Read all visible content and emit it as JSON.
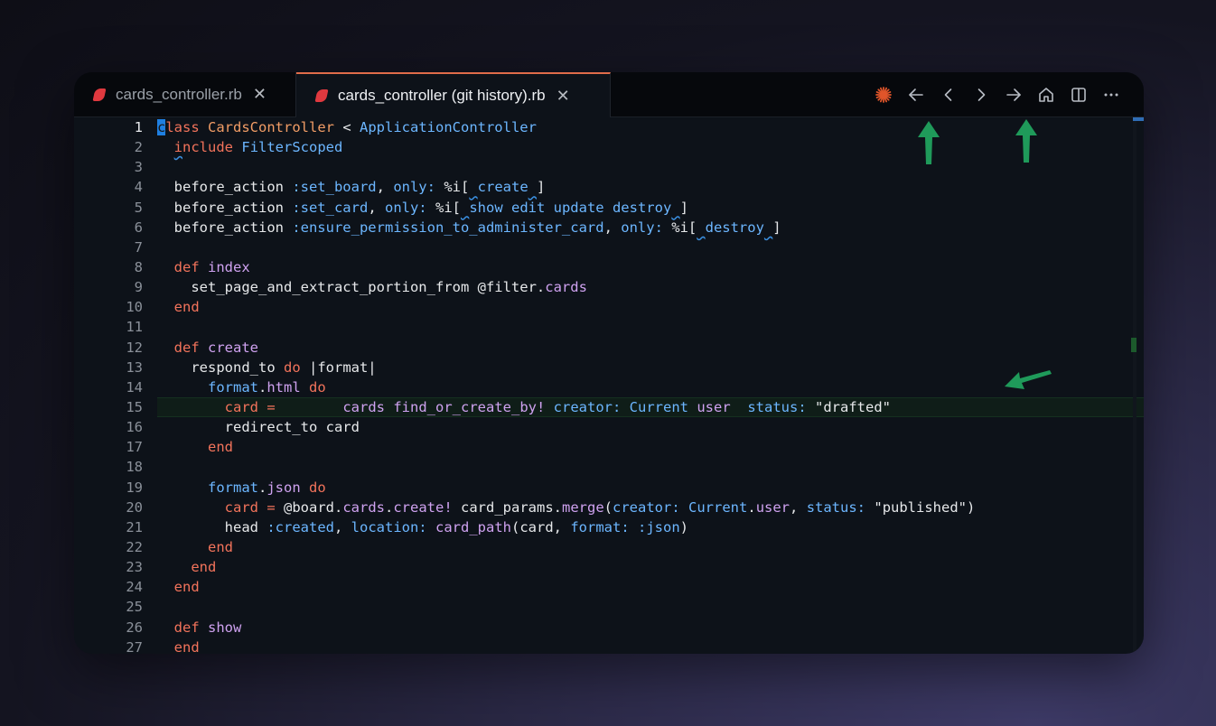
{
  "tabs": [
    {
      "label": "cards_controller.rb",
      "close": "✕",
      "active": false
    },
    {
      "label": "cards_controller (git history).rb",
      "close": "✕",
      "active": true
    }
  ],
  "toolbar": {
    "icons": [
      "sparkle-icon",
      "arrow-left-icon",
      "chevron-left-icon",
      "chevron-right-icon",
      "arrow-right-icon",
      "home-icon",
      "split-icon",
      "more-icon"
    ],
    "accent": "#e0552a"
  },
  "editor": {
    "active_line": 1,
    "highlighted_line": 15,
    "line_numbers": [
      "1",
      "2",
      "3",
      "4",
      "5",
      "6",
      "7",
      "8",
      "9",
      "10",
      "11",
      "12",
      "13",
      "14",
      "15",
      "16",
      "17",
      "18",
      "19",
      "20",
      "21",
      "22",
      "23",
      "24",
      "25",
      "26",
      "27"
    ]
  },
  "annotation_color": "#1f9a5a"
}
